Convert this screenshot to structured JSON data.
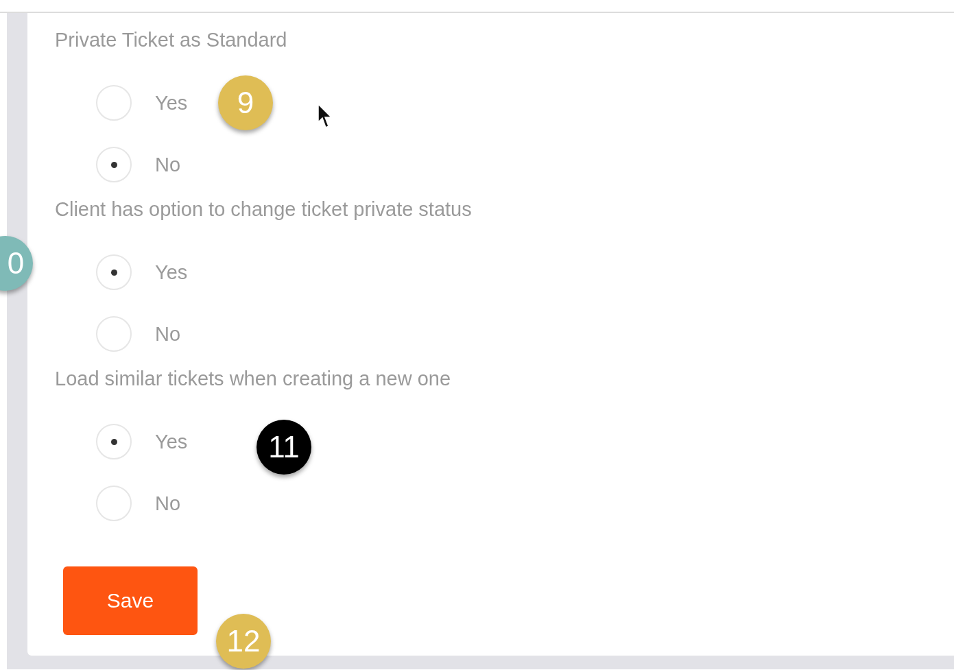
{
  "settings": [
    {
      "label": "Private Ticket as Standard",
      "options": [
        {
          "label": "Yes",
          "selected": false
        },
        {
          "label": "No",
          "selected": true
        }
      ]
    },
    {
      "label": "Client has option to change ticket private status",
      "options": [
        {
          "label": "Yes",
          "selected": true
        },
        {
          "label": "No",
          "selected": false
        }
      ]
    },
    {
      "label": "Load similar tickets when creating a new one",
      "options": [
        {
          "label": "Yes",
          "selected": true
        },
        {
          "label": "No",
          "selected": false
        }
      ]
    }
  ],
  "save_button": "Save",
  "annotations": [
    {
      "label": "9",
      "color": "#dfbd55"
    },
    {
      "label": "0",
      "color": "#7fbab7"
    },
    {
      "label": "11",
      "color": "#000000"
    },
    {
      "label": "12",
      "color": "#dfbd55"
    }
  ]
}
